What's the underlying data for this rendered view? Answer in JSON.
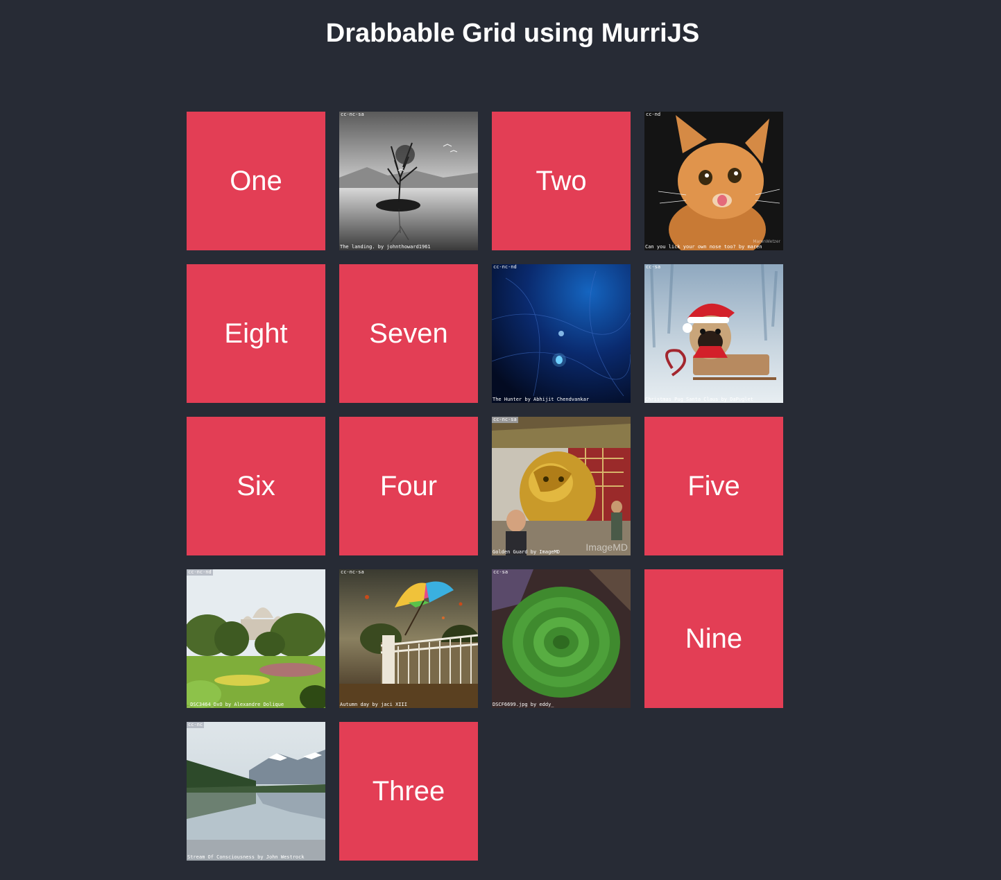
{
  "page": {
    "title": "Drabbable Grid using MurriJS"
  },
  "colors": {
    "background": "#272b35",
    "tile": "#e33e55",
    "text": "#ffffff"
  },
  "tiles": [
    {
      "type": "text",
      "label": "One"
    },
    {
      "type": "image",
      "license": "cc-nc-sa",
      "caption": "The landing. by johnthoward1961",
      "subject": "lone tree on rock in lake"
    },
    {
      "type": "text",
      "label": "Two"
    },
    {
      "type": "image",
      "license": "cc-nd",
      "caption": "Can you lick your own nose too? by maren",
      "subject": "kitten licking nose",
      "watermark": "MarenWetzer"
    },
    {
      "type": "text",
      "label": "Eight"
    },
    {
      "type": "text",
      "label": "Seven"
    },
    {
      "type": "image",
      "license": "cc-nc-nd",
      "caption": "The Hunter by Abhijit Chendvankar",
      "subject": "deep sea jellyfish"
    },
    {
      "type": "image",
      "license": "cc-sa",
      "caption": "Christmas Pug Santa Claus by DaPuglet",
      "subject": "pug in santa hat"
    },
    {
      "type": "text",
      "label": "Six"
    },
    {
      "type": "text",
      "label": "Four"
    },
    {
      "type": "image",
      "license": "cc-nc-sa",
      "caption": "Golden Guard by ImageMD",
      "subject": "golden lion statue",
      "watermark": "ImageMD"
    },
    {
      "type": "text",
      "label": "Five"
    },
    {
      "type": "image",
      "license": "cc-nc-nd",
      "caption": "_DSC3464_DxO by Alexandre Dolique",
      "subject": "garden with domed building"
    },
    {
      "type": "image",
      "license": "cc-nc-sa",
      "caption": "Autumn day by jaci XIII",
      "subject": "rainbow umbrella over bridge"
    },
    {
      "type": "image",
      "license": "cc-sa",
      "caption": "DSCF6699.jpg by eddy_",
      "subject": "green leaves bundle"
    },
    {
      "type": "text",
      "label": "Nine"
    },
    {
      "type": "image",
      "license": "cc-nc",
      "caption": "Stream Of Consciousness by John Westrock",
      "subject": "mountain lake reflection"
    },
    {
      "type": "text",
      "label": "Three"
    }
  ]
}
